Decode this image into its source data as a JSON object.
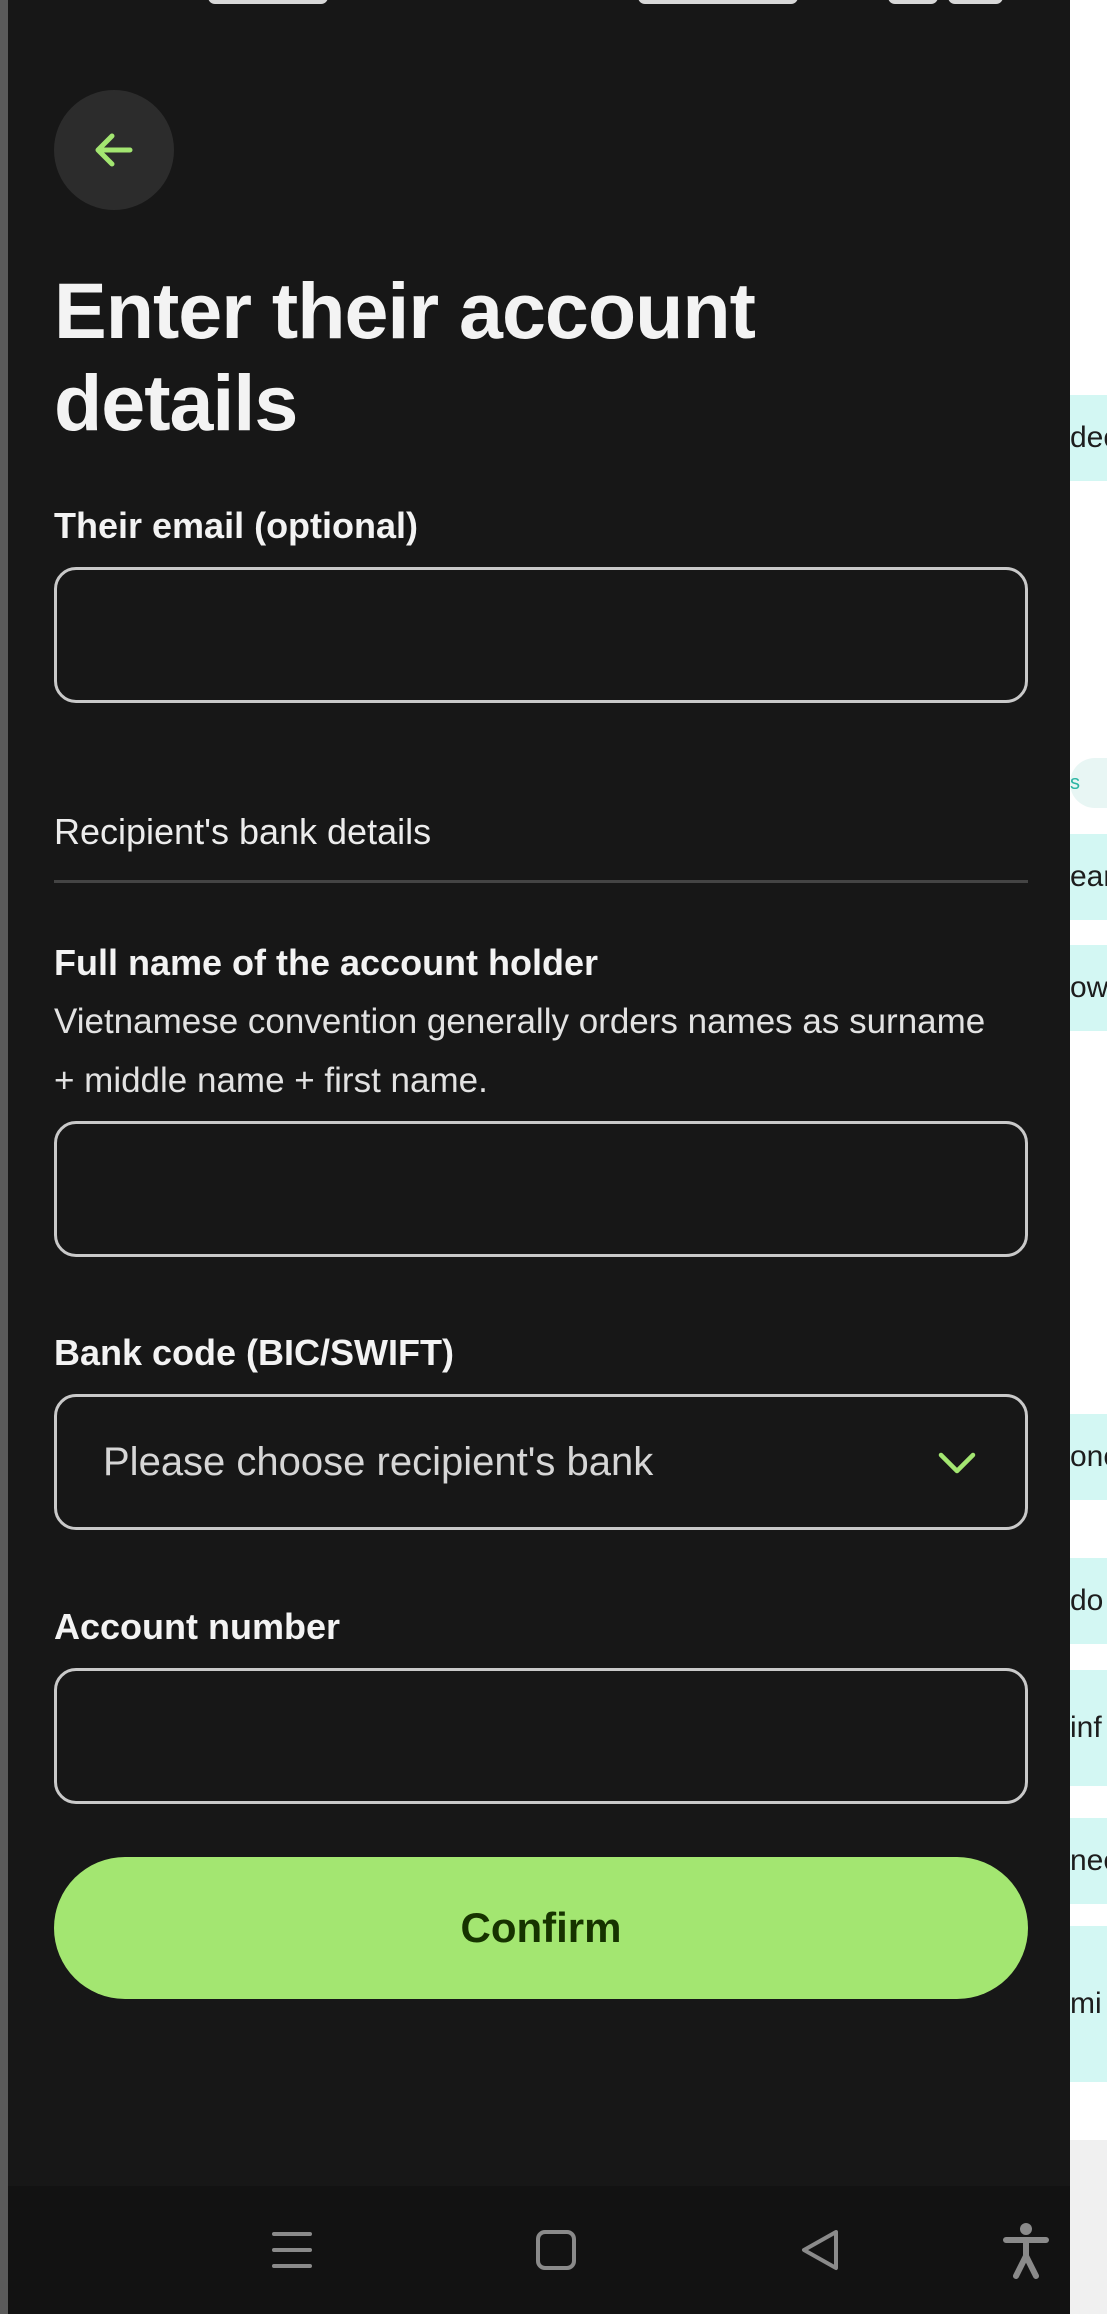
{
  "screen": {
    "title": "Enter their account details",
    "email": {
      "label": "Their email (optional)",
      "value": "",
      "placeholder": ""
    },
    "section_heading": "Recipient's bank details",
    "full_name": {
      "label": "Full name of the account holder",
      "hint": "Vietnamese convention generally orders names as surname + middle name + first name.",
      "value": "",
      "placeholder": ""
    },
    "bank_code": {
      "label": "Bank code (BIC/SWIFT)",
      "selected": "Please choose recipient's bank"
    },
    "account_number": {
      "label": "Account number",
      "value": "",
      "placeholder": ""
    },
    "confirm_label": "Confirm"
  },
  "background_chips": [
    "dec",
    "s",
    "ear",
    "ow",
    "one",
    "do",
    "inf",
    "nee",
    "mi"
  ],
  "nav": {
    "icons": [
      "menu-icon",
      "home-icon",
      "back-triangle-icon",
      "accessibility-icon"
    ]
  },
  "colors": {
    "accent": "#a3e671",
    "background": "#171717",
    "button_text": "#163300"
  }
}
